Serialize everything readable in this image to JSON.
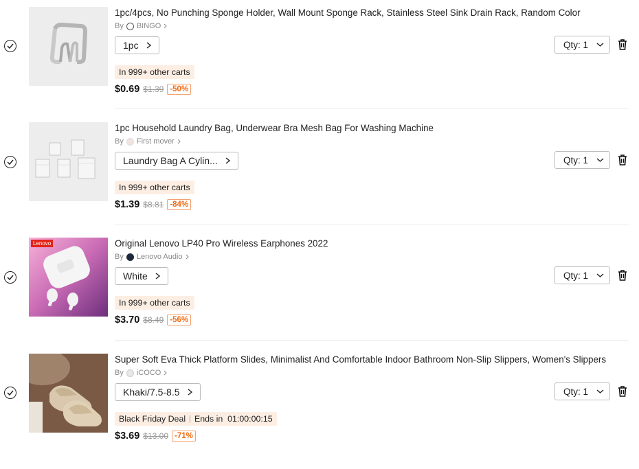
{
  "items": [
    {
      "title": "1pc/4pcs, No Punching Sponge Holder, Wall Mount Sponge Rack, Stainless Steel Sink Drain Rack, Random Color",
      "by": "By",
      "store": "BINGO",
      "variant": "1pc",
      "badge": "In 999+ other carts",
      "price": "$0.69",
      "old_price": "$1.39",
      "discount": "-50%",
      "qty": "Qty: 1"
    },
    {
      "title": "1pc Household Laundry Bag, Underwear Bra Mesh Bag For Washing Machine",
      "by": "By",
      "store": "First mover",
      "variant": "Laundry Bag A Cylin...",
      "badge": "In 999+ other carts",
      "price": "$1.39",
      "old_price": "$8.81",
      "discount": "-84%",
      "qty": "Qty: 1"
    },
    {
      "title": "Original Lenovo LP40 Pro Wireless Earphones 2022",
      "by": "By",
      "store": "Lenovo Audio",
      "variant": "White",
      "badge": "In 999+ other carts",
      "price": "$3.70",
      "old_price": "$8.49",
      "discount": "-56%",
      "qty": "Qty: 1",
      "thumb_tag": "Lenovo"
    },
    {
      "title": "Super Soft Eva Thick Platform Slides, Minimalist And Comfortable Indoor Bathroom Non-Slip Slippers, Women's Slippers",
      "by": "By",
      "store": "iCOCO",
      "variant": "Khaki/7.5-8.5",
      "badge": "Black Friday Deal",
      "badge_extra": "Ends in  01:00:00:15",
      "price": "$3.69",
      "old_price": "$13.00",
      "discount": "-71%",
      "qty": "Qty: 1"
    }
  ],
  "colors": {
    "badge_bg": "#fdeee3",
    "discount": "#f06a12",
    "lenovo_red": "#e2231a"
  },
  "icons": [
    "check-circle-icon",
    "chevron-right-icon",
    "chevron-down-icon",
    "trash-icon"
  ]
}
